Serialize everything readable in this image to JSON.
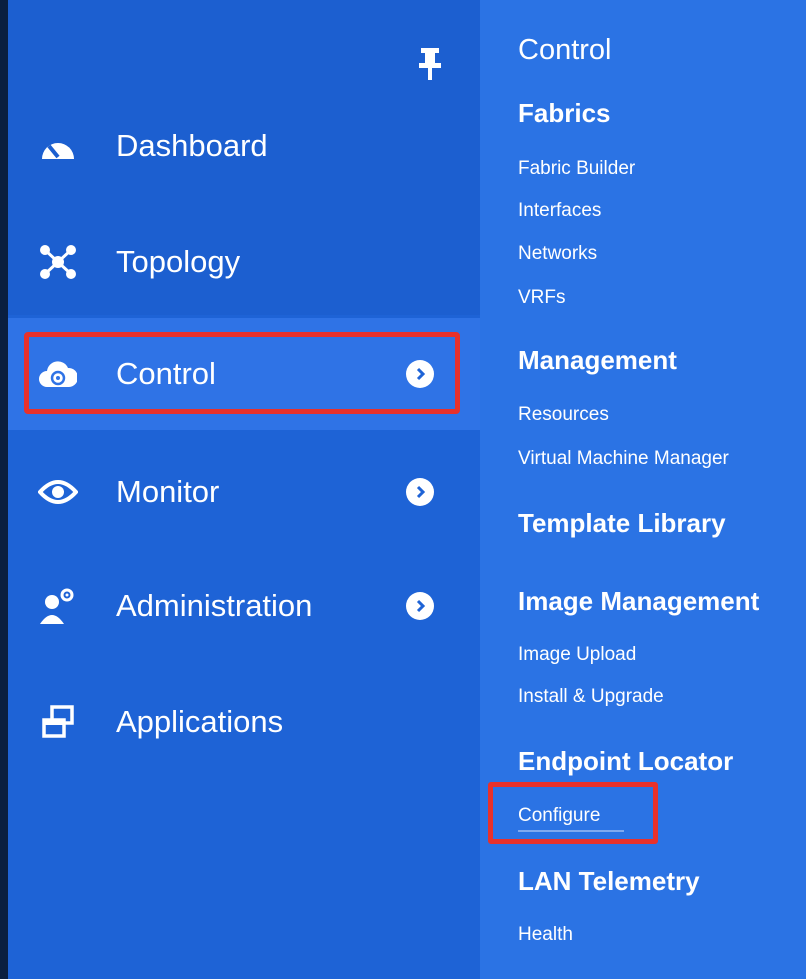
{
  "sidebar": {
    "items": [
      {
        "label": "Dashboard",
        "icon": "dashboard-gauge-icon"
      },
      {
        "label": "Topology",
        "icon": "topology-icon"
      },
      {
        "label": "Control",
        "icon": "control-cloud-icon",
        "has_submenu": true,
        "active": true
      },
      {
        "label": "Monitor",
        "icon": "eye-icon",
        "has_submenu": true
      },
      {
        "label": "Administration",
        "icon": "admin-user-gear-icon",
        "has_submenu": true
      },
      {
        "label": "Applications",
        "icon": "applications-windows-icon"
      }
    ],
    "pin_icon": "pin-icon"
  },
  "submenu": {
    "title": "Control",
    "sections": [
      {
        "heading": "Fabrics",
        "links": [
          "Fabric Builder",
          "Interfaces",
          "Networks",
          "VRFs"
        ]
      },
      {
        "heading": "Management",
        "links": [
          "Resources",
          "Virtual Machine Manager"
        ]
      },
      {
        "heading": "Template Library",
        "links": []
      },
      {
        "heading": "Image Management",
        "links": [
          "Image Upload",
          "Install & Upgrade"
        ]
      },
      {
        "heading": "Endpoint Locator",
        "links": [
          "Configure"
        ]
      },
      {
        "heading": "LAN Telemetry",
        "links": [
          "Health"
        ]
      }
    ]
  },
  "highlight_color": "#e8312b"
}
